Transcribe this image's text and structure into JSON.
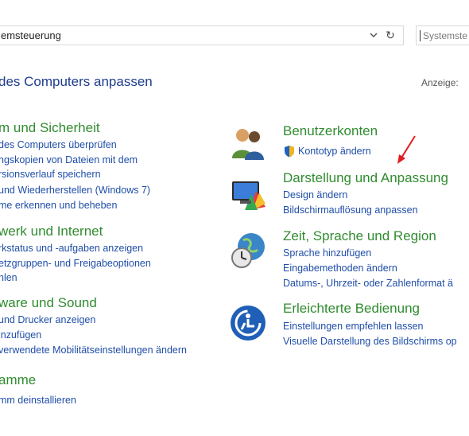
{
  "address": {
    "path": "emsteuerung",
    "search_placeholder": "Systemste"
  },
  "header": {
    "title": "des Computers anpassen",
    "view_label": "Anzeige:"
  },
  "left_column": [
    {
      "title": "m und Sicherheit",
      "links": [
        "des Computers überprüfen",
        "ngskopien von Dateien mit dem",
        "rsionsverlauf speichern",
        "und Wiederherstellen (Windows 7)",
        "me erkennen und beheben"
      ]
    },
    {
      "title": "werk und Internet",
      "links": [
        "rkstatus und -aufgaben anzeigen",
        "etzgruppen- und Freigabeoptionen",
        "hlen"
      ]
    },
    {
      "title": "ware und Sound",
      "links": [
        "und Drucker anzeigen",
        "inzufügen",
        "verwendete Mobilitätseinstellungen ändern"
      ]
    },
    {
      "title": "amme",
      "links": [
        "mm deinstallieren"
      ]
    }
  ],
  "right_column": [
    {
      "icon": "user-accounts-icon",
      "title": "Benutzerkonten",
      "links": [
        "Kontotyp ändern"
      ]
    },
    {
      "icon": "appearance-icon",
      "title": "Darstellung und Anpassung",
      "links": [
        "Design ändern",
        "Bildschirmauflösung anpassen"
      ]
    },
    {
      "icon": "clock-globe-icon",
      "title": "Zeit, Sprache und Region",
      "links": [
        "Sprache hinzufügen",
        "Eingabemethoden ändern",
        "Datums-, Uhrzeit- oder Zahlenformat ä"
      ]
    },
    {
      "icon": "ease-of-access-icon",
      "title": "Erleichterte Bedienung",
      "links": [
        "Einstellungen empfehlen lassen",
        "Visuelle Darstellung des Bildschirms op"
      ]
    }
  ],
  "colors": {
    "category_title": "#2f8c2f",
    "link": "#1f4ea8",
    "title": "#1e3c8c",
    "annotation_arrow": "#e02020"
  }
}
